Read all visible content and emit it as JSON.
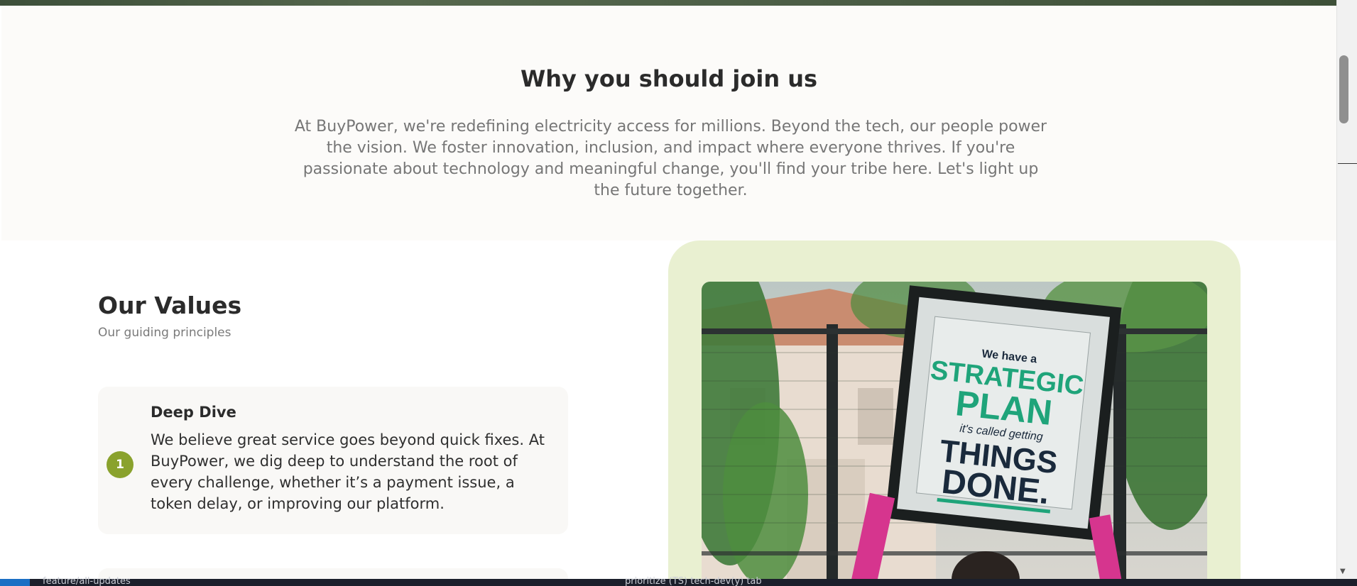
{
  "why_section": {
    "title": "Why you should join us",
    "text": "At BuyPower, we're redefining electricity access for millions. Beyond the tech, our people power the vision. We foster innovation, inclusion, and impact where everyone thrives. If you're passionate about technology and meaningful change, you'll find your tribe here. Let's light up the future together."
  },
  "values_section": {
    "title": "Our Values",
    "subtitle": "Our guiding principles",
    "items": [
      {
        "number": "1",
        "title": "Deep Dive",
        "text": "We believe great service goes beyond quick fixes. At BuyPower, we dig deep to understand the root of every challenge, whether it’s a payment issue, a token delay, or improving our platform."
      }
    ]
  },
  "photo": {
    "sign_line1": "We have a",
    "sign_line2": "STRATEGIC",
    "sign_line3": "PLAN",
    "sign_line4": "it's called getting",
    "sign_line5": "THINGS",
    "sign_line6": "DONE."
  },
  "taskbar": {
    "left_text": "feature/all-updates",
    "right_text": "prioritize (TS) tech-dev(y) tab"
  },
  "colors": {
    "accent_green": "#8aa22d",
    "panel_green": "#e9f0d1",
    "sign_green": "#1fa47a",
    "sign_navy": "#1a2a3c"
  }
}
